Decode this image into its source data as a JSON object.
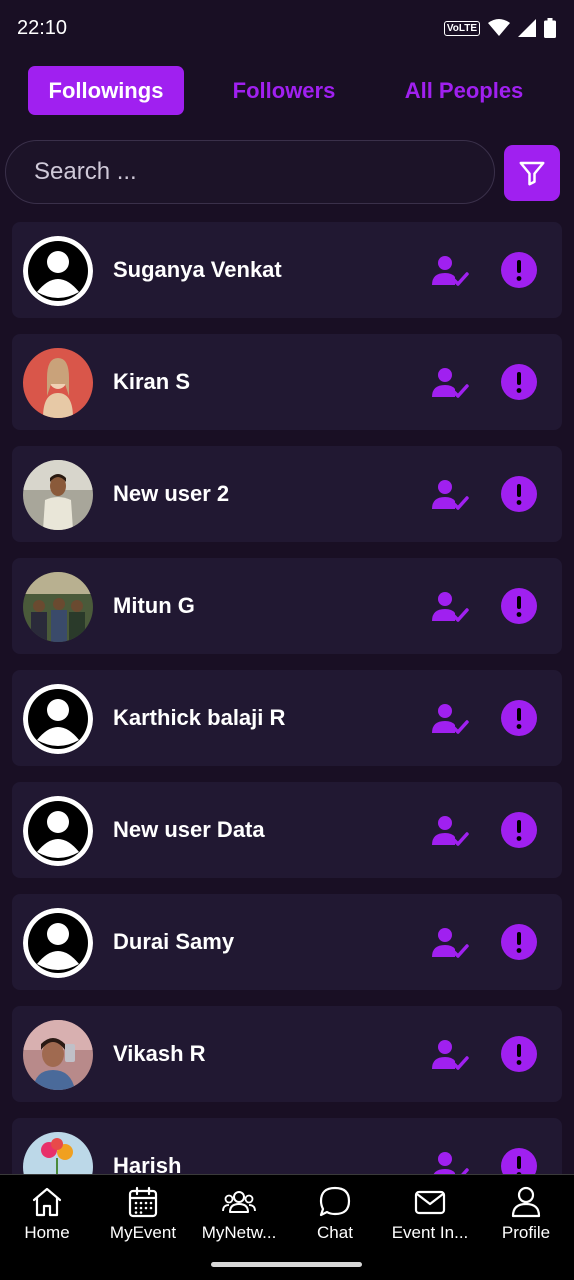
{
  "status": {
    "time": "22:10",
    "network_badge": "VoLTE"
  },
  "tabs": [
    {
      "label": "Followings",
      "active": true
    },
    {
      "label": "Followers",
      "active": false
    },
    {
      "label": "All Peoples",
      "active": false
    }
  ],
  "search": {
    "placeholder": "Search ..."
  },
  "people": [
    {
      "name": "Suganya Venkat",
      "avatar": "default-avatar"
    },
    {
      "name": "Kiran S",
      "avatar": "photo"
    },
    {
      "name": "New user 2",
      "avatar": "photo"
    },
    {
      "name": "Mitun G",
      "avatar": "photo"
    },
    {
      "name": "Karthick balaji R",
      "avatar": "default-avatar"
    },
    {
      "name": "New user Data",
      "avatar": "default-avatar"
    },
    {
      "name": "Durai Samy",
      "avatar": "default-avatar"
    },
    {
      "name": "Vikash R",
      "avatar": "photo"
    },
    {
      "name": "Harish",
      "avatar": "photo"
    }
  ],
  "nav": [
    {
      "label": "Home",
      "icon": "home-icon"
    },
    {
      "label": "MyEvent",
      "icon": "calendar-icon"
    },
    {
      "label": "MyNetw...",
      "icon": "people-icon"
    },
    {
      "label": "Chat",
      "icon": "chat-icon"
    },
    {
      "label": "Event In...",
      "icon": "mail-icon"
    },
    {
      "label": "Profile",
      "icon": "user-icon"
    }
  ],
  "colors": {
    "accent": "#a020f0",
    "background": "#190f24",
    "card": "#211832"
  }
}
